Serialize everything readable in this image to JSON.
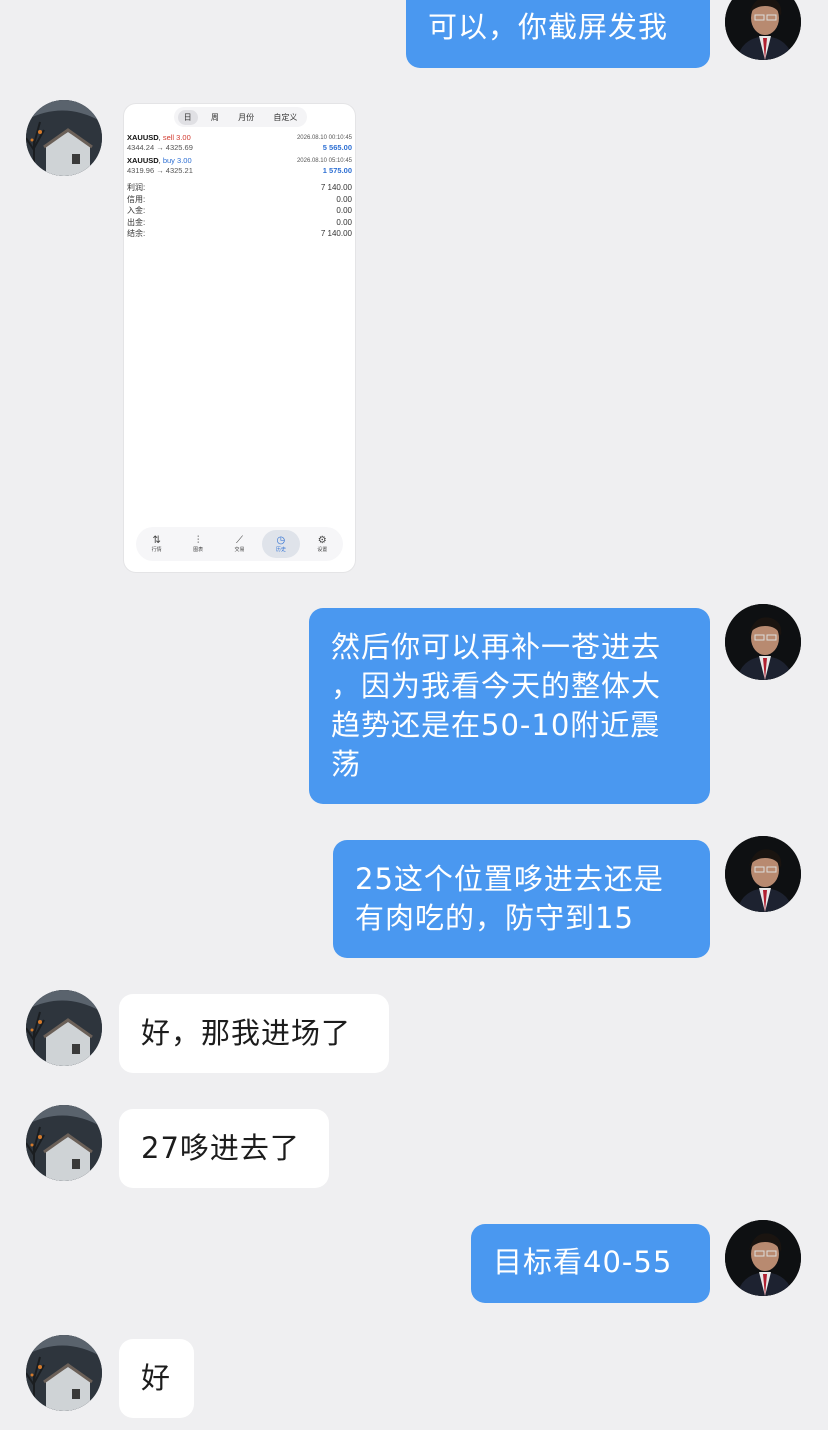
{
  "messages": {
    "m1": "可以，你截屏发我",
    "m3_l1": "然后你可以再补一苍进去",
    "m3_l2": "，因为我看今天的整体大",
    "m3_l3": "趋势还是在50-10附近震",
    "m3_l4": "荡",
    "m4_l1": "25这个位置哆进去还是",
    "m4_l2": "有肉吃的，防守到15",
    "m5": "好，那我进场了",
    "m6": "27哆进去了",
    "m7": "目标看40-55",
    "m8": "好"
  },
  "screenshot": {
    "segments": [
      "日",
      "周",
      "月份",
      "自定义"
    ],
    "deals": [
      {
        "symbol": "XAUUSD",
        "side": "sell 3.00",
        "time": "2026.08.10 00:10:45",
        "prices": "4344.24 → 4325.69",
        "profit": "5 565.00"
      },
      {
        "symbol": "XAUUSD",
        "side": "buy 3.00",
        "time": "2026.08.10 05:10:45",
        "prices": "4319.96 → 4325.21",
        "profit": "1 575.00"
      }
    ],
    "summary": [
      {
        "label": "利润:",
        "value": "7 140.00"
      },
      {
        "label": "信用:",
        "value": "0.00"
      },
      {
        "label": "入金:",
        "value": "0.00"
      },
      {
        "label": "出金:",
        "value": "0.00"
      },
      {
        "label": "结余:",
        "value": "7 140.00"
      }
    ],
    "tabs": [
      {
        "icon": "⇅",
        "label": "行情"
      },
      {
        "icon": "⫶",
        "label": "图表"
      },
      {
        "icon": "⟋",
        "label": "交易"
      },
      {
        "icon": "◷",
        "label": "历史"
      },
      {
        "icon": "⚙",
        "label": "设置"
      }
    ]
  },
  "colors": {
    "background": "#efeff1",
    "outgoing_bubble": "#4a98f0",
    "incoming_bubble": "#ffffff"
  }
}
